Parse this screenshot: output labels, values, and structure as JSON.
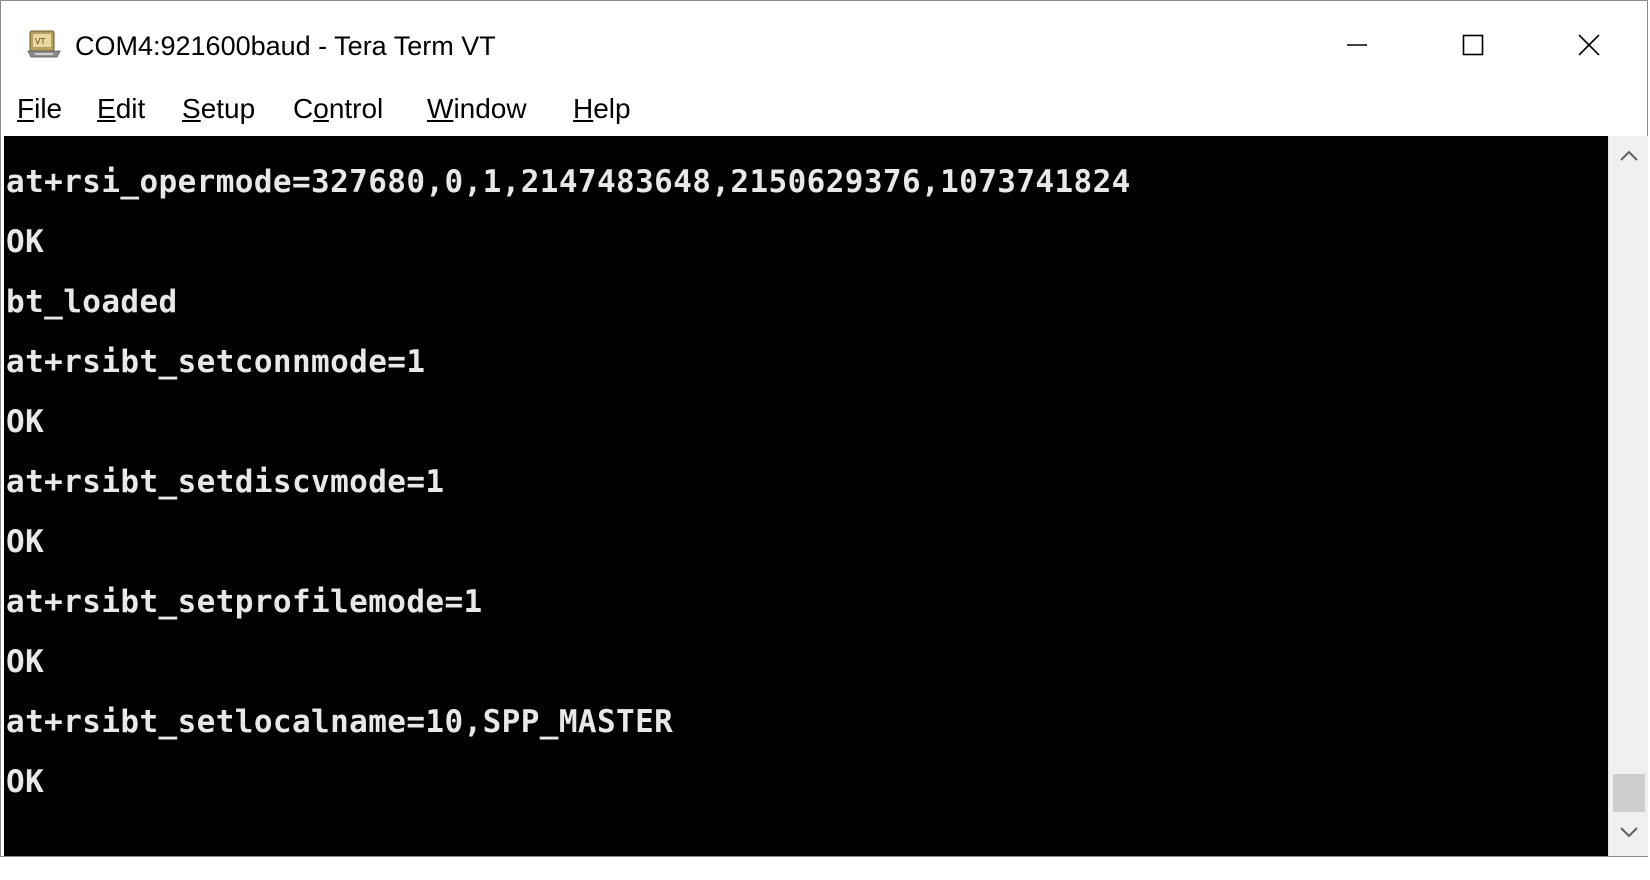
{
  "window": {
    "title": "COM4:921600baud - Tera Term VT",
    "icon": "tera-term-app-icon",
    "controls": {
      "minimize": "minimize-icon",
      "maximize": "maximize-icon",
      "close": "close-icon"
    }
  },
  "menu": {
    "items": [
      {
        "accel": "F",
        "rest": "ile"
      },
      {
        "accel": "E",
        "rest": "dit"
      },
      {
        "accel": "S",
        "rest": "etup"
      },
      {
        "pre": "C",
        "accel": "o",
        "rest": "ntrol"
      },
      {
        "accel": "W",
        "rest": "indow"
      },
      {
        "accel": "H",
        "rest": "elp"
      }
    ]
  },
  "terminal": {
    "background": "#000000",
    "foreground": "#e8e8e8",
    "lines": [
      "at+rsi_opermode=327680,0,1,2147483648,2150629376,1073741824",
      "OK",
      "bt_loaded",
      "at+rsibt_setconnmode=1",
      "OK",
      "at+rsibt_setdiscvmode=1",
      "OK",
      "at+rsibt_setprofilemode=1",
      "OK",
      "at+rsibt_setlocalname=10,SPP_MASTER",
      "OK"
    ]
  },
  "scrollbar": {
    "up": "chevron-up-icon",
    "down": "chevron-down-icon",
    "position": "bottom"
  }
}
